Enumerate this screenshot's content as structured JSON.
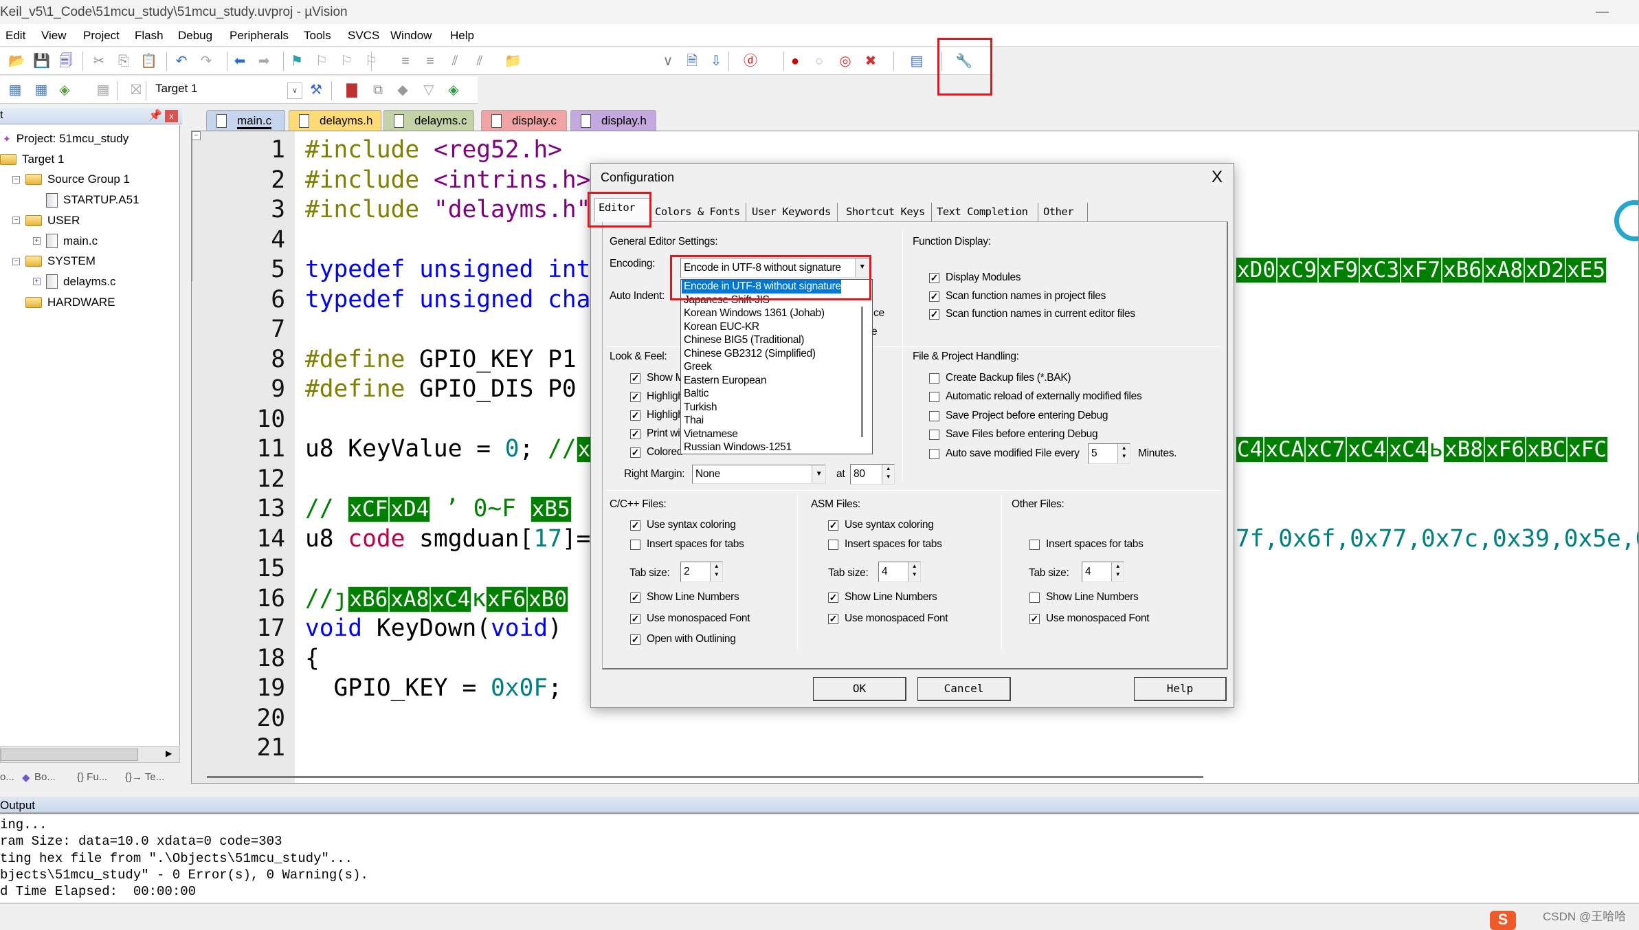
{
  "window": {
    "title": "Keil_v5\\1_Code\\51mcu_study\\51mcu_study.uvproj - µVision",
    "minimize": "—"
  },
  "menu": [
    "Edit",
    "View",
    "Project",
    "Flash",
    "Debug",
    "Peripherals",
    "Tools",
    "SVCS",
    "Window",
    "Help"
  ],
  "toolbar1": {
    "icons": [
      "open-icon",
      "save-icon",
      "save-all-icon",
      "cut-icon",
      "copy-icon",
      "paste-icon",
      "undo-icon",
      "redo-icon",
      "nav-back-icon",
      "nav-forward-icon",
      "bookmark-icon",
      "prev-bookmark-icon",
      "next-bookmark-icon",
      "clear-bookmarks-icon",
      "indent-icon",
      "unindent-icon",
      "comment-icon",
      "uncomment-icon",
      "find-in-files-icon",
      "find-combo",
      "incremental-find-icon",
      "find-icon",
      "debug-session-icon",
      "breakpoint-insert-icon",
      "breakpoint-disable-icon",
      "breakpoint-disable-all-icon",
      "breakpoint-kill-all-icon",
      "window-layout-icon",
      "configuration-wrench-icon"
    ]
  },
  "toolbar2": {
    "target": "Target 1",
    "icons": [
      "translate-icon",
      "build-icon",
      "rebuild-icon",
      "batch-build-icon",
      "stop-build-icon",
      "load-icon",
      "target-options-icon",
      "manage-components-icon",
      "select-packs-icon",
      "pack-installer-icon",
      "manage-rte-icon",
      "run-time-env-icon"
    ]
  },
  "project_panel": {
    "title": "t",
    "tree": [
      {
        "label": "Project: 51mcu_study",
        "kind": "project"
      },
      {
        "label": "Target 1",
        "kind": "target"
      },
      {
        "label": "Source Group 1",
        "kind": "folder"
      },
      {
        "label": "STARTUP.A51",
        "kind": "file"
      },
      {
        "label": "USER",
        "kind": "folder"
      },
      {
        "label": "main.c",
        "kind": "file"
      },
      {
        "label": "SYSTEM",
        "kind": "folder"
      },
      {
        "label": "delayms.c",
        "kind": "file"
      },
      {
        "label": "HARDWARE",
        "kind": "folder"
      }
    ],
    "bottom_tabs": [
      "o...",
      "Bo...",
      "{} Fu...",
      "{}→ Te..."
    ]
  },
  "editor_tabs": [
    {
      "label": "main.c",
      "color": "#c5d5ee",
      "active": true
    },
    {
      "label": "delayms.h",
      "color": "#ffdb75"
    },
    {
      "label": "delayms.c",
      "color": "#c3d3a6"
    },
    {
      "label": "display.c",
      "color": "#f0a4a4"
    },
    {
      "label": "display.h",
      "color": "#c4a8e0"
    }
  ],
  "code": [
    {
      "n": "1",
      "t": [
        [
          "pp",
          "#include"
        ],
        [
          "",
          " "
        ],
        [
          "str",
          "<reg52.h>"
        ]
      ]
    },
    {
      "n": "2",
      "t": [
        [
          "pp",
          "#include"
        ],
        [
          "",
          " "
        ],
        [
          "str",
          "<intrins.h>"
        ]
      ]
    },
    {
      "n": "3",
      "t": [
        [
          "pp",
          "#include"
        ],
        [
          "",
          " "
        ],
        [
          "str",
          "\"delayms.h\""
        ]
      ]
    },
    {
      "n": "4",
      "t": []
    },
    {
      "n": "5",
      "t": [
        [
          "kw",
          "typedef"
        ],
        [
          "",
          " "
        ],
        [
          "kw",
          "unsigned"
        ],
        [
          "",
          " "
        ],
        [
          "kw",
          "int"
        ]
      ],
      "r": [
        [
          "hex",
          "xD0"
        ],
        [
          "hex",
          "xC9"
        ],
        [
          "hex",
          "xF9"
        ],
        [
          "hex",
          "xC3"
        ],
        [
          "hex",
          "xF7"
        ],
        [
          "hex",
          "xB6"
        ],
        [
          "hex",
          "xA8"
        ],
        [
          "hex",
          "xD2"
        ],
        [
          "hex",
          "xE5"
        ]
      ]
    },
    {
      "n": "6",
      "t": [
        [
          "kw",
          "typedef"
        ],
        [
          "",
          " "
        ],
        [
          "kw",
          "unsigned"
        ],
        [
          "",
          " "
        ],
        [
          "kw",
          "cha"
        ]
      ]
    },
    {
      "n": "7",
      "t": []
    },
    {
      "n": "8",
      "t": [
        [
          "pp",
          "#define"
        ],
        [
          "",
          " GPIO_KEY P1"
        ]
      ]
    },
    {
      "n": "9",
      "t": [
        [
          "pp",
          "#define"
        ],
        [
          "",
          " GPIO_DIS P0"
        ]
      ]
    },
    {
      "n": "10",
      "t": []
    },
    {
      "n": "11",
      "t": [
        [
          "",
          "u8 KeyValue = "
        ],
        [
          "num",
          "0"
        ],
        [
          "",
          "; "
        ],
        [
          "cm",
          "//"
        ],
        [
          "hex",
          "x"
        ]
      ],
      "r": [
        [
          "hex",
          "C4"
        ],
        [
          "hex",
          "xCA"
        ],
        [
          "hex",
          "xC7"
        ],
        [
          "hex",
          "xC4"
        ],
        [
          "hex",
          "xC4"
        ],
        [
          "cm",
          "ь"
        ],
        [
          "hex",
          "xB8"
        ],
        [
          "hex",
          "xF6"
        ],
        [
          "hex",
          "xBC"
        ],
        [
          "hex",
          "xFC"
        ]
      ]
    },
    {
      "n": "12",
      "t": []
    },
    {
      "n": "13",
      "t": [
        [
          "cm",
          "// "
        ],
        [
          "hex",
          "xCF"
        ],
        [
          "hex",
          "xD4"
        ],
        [
          "cm",
          " ʼ 0~F "
        ],
        [
          "hex",
          "xB5"
        ]
      ]
    },
    {
      "n": "14",
      "t": [
        [
          "",
          "u8 "
        ],
        [
          "code",
          "code"
        ],
        [
          "",
          " smgduan["
        ],
        [
          "num",
          "17"
        ],
        [
          "",
          "]="
        ]
      ],
      "r": [
        [
          "num",
          "7f,0x6f,0x77,0x7c,0x39,0x5e,0"
        ]
      ]
    },
    {
      "n": "15",
      "t": []
    },
    {
      "n": "16",
      "t": [
        [
          "cm",
          "//ȷ"
        ],
        [
          "hex",
          "xB6"
        ],
        [
          "hex",
          "xA8"
        ],
        [
          "hex",
          "xC4"
        ],
        [
          "cm",
          "κ"
        ],
        [
          "hex",
          "xF6"
        ],
        [
          "hex",
          "xB0"
        ]
      ]
    },
    {
      "n": "17",
      "t": [
        [
          "kw",
          "void"
        ],
        [
          "",
          " KeyDown("
        ],
        [
          "kw",
          "void"
        ],
        [
          "",
          ")"
        ]
      ]
    },
    {
      "n": "18",
      "t": [
        [
          "",
          "{"
        ]
      ],
      "fold": true
    },
    {
      "n": "19",
      "t": [
        [
          "",
          "  GPIO_KEY = "
        ],
        [
          "num",
          "0x0F"
        ],
        [
          "",
          ";"
        ]
      ]
    },
    {
      "n": "20",
      "t": []
    },
    {
      "n": "21",
      "t": []
    }
  ],
  "output": {
    "title": "Output",
    "lines": [
      "ing...",
      "ram Size: data=10.0 xdata=0 code=303",
      "ting hex file from \".\\Objects\\51mcu_study\"...",
      "bjects\\51mcu_study\" - 0 Error(s), 0 Warning(s).",
      "d Time Elapsed:  00:00:00"
    ]
  },
  "watermark": "CSDN @王哈哈",
  "dialog": {
    "title": "Configuration",
    "close": "X",
    "tabs": [
      "Editor",
      "Colors & Fonts",
      "User Keywords",
      "Shortcut Keys",
      "Text Completion",
      "Other"
    ],
    "general": {
      "heading": "General Editor Settings:",
      "encoding_label": "Encoding:",
      "encoding_value": "Encode in UTF-8 without signature",
      "encoding_options": [
        "Encode in UTF-8 without signature",
        "Japanese Shift-JIS",
        "Korean Windows 1361 (Johab)",
        "Korean EUC-KR",
        "Chinese BIG5 (Traditional)",
        "Chinese GB2312 (Simplified)",
        "Greek",
        "Eastern European",
        "Baltic",
        "Turkish",
        "Thai",
        "Vietnamese",
        "Russian Windows-1251"
      ],
      "auto_indent_label": "Auto Indent:",
      "hidden_fragment_1": "ce",
      "hidden_fragment_2": "e"
    },
    "function_display": {
      "heading": "Function Display:",
      "items": [
        {
          "label": "Display Modules",
          "checked": true
        },
        {
          "label": "Scan function names in project files",
          "checked": true
        },
        {
          "label": "Scan function names in current editor files",
          "checked": true
        }
      ]
    },
    "look_feel": {
      "heading": "Look & Feel:",
      "items": [
        {
          "label": "Show M",
          "checked": true
        },
        {
          "label": "Highligh",
          "checked": true
        },
        {
          "label": "Highligh",
          "checked": true
        },
        {
          "label": "Print wit",
          "checked": true
        },
        {
          "label": "Colored",
          "checked": true
        }
      ],
      "right_margin_label": "Right Margin:",
      "right_margin_value": "None",
      "at_label": "at",
      "at_value": "80"
    },
    "file_project": {
      "heading": "File & Project Handling:",
      "items": [
        {
          "label": "Create Backup files (*.BAK)",
          "checked": false
        },
        {
          "label": "Automatic reload of externally modified files",
          "checked": false
        },
        {
          "label": "Save Project before entering Debug",
          "checked": false
        },
        {
          "label": "Save Files before entering Debug",
          "checked": false
        },
        {
          "label": "Auto save modified File every",
          "checked": false
        }
      ],
      "autosave_value": "5",
      "minutes_label": "Minutes."
    },
    "cpp": {
      "heading": "C/C++ Files:",
      "syntax": {
        "label": "Use syntax coloring",
        "checked": true
      },
      "spaces": {
        "label": "Insert spaces for tabs",
        "checked": false
      },
      "tab_label": "Tab size:",
      "tab_size": "2",
      "line_numbers": {
        "label": "Show Line Numbers",
        "checked": true
      },
      "mono": {
        "label": "Use monospaced Font",
        "checked": true
      },
      "outlining": {
        "label": "Open with Outlining",
        "checked": true
      }
    },
    "asm": {
      "heading": "ASM Files:",
      "syntax": {
        "label": "Use syntax coloring",
        "checked": true
      },
      "spaces": {
        "label": "Insert spaces for tabs",
        "checked": false
      },
      "tab_label": "Tab size:",
      "tab_size": "4",
      "line_numbers": {
        "label": "Show Line Numbers",
        "checked": true
      },
      "mono": {
        "label": "Use monospaced Font",
        "checked": true
      }
    },
    "other": {
      "heading": "Other Files:",
      "spaces": {
        "label": "Insert spaces for tabs",
        "checked": false
      },
      "tab_label": "Tab size:",
      "tab_size": "4",
      "line_numbers": {
        "label": "Show Line Numbers",
        "checked": false
      },
      "mono": {
        "label": "Use monospaced Font",
        "checked": true
      }
    },
    "buttons": {
      "ok": "OK",
      "cancel": "Cancel",
      "help": "Help"
    }
  },
  "colors": {
    "highlight_box": "#e8141c",
    "selection": "#0078d7",
    "hex_token_bg": "#008000"
  }
}
